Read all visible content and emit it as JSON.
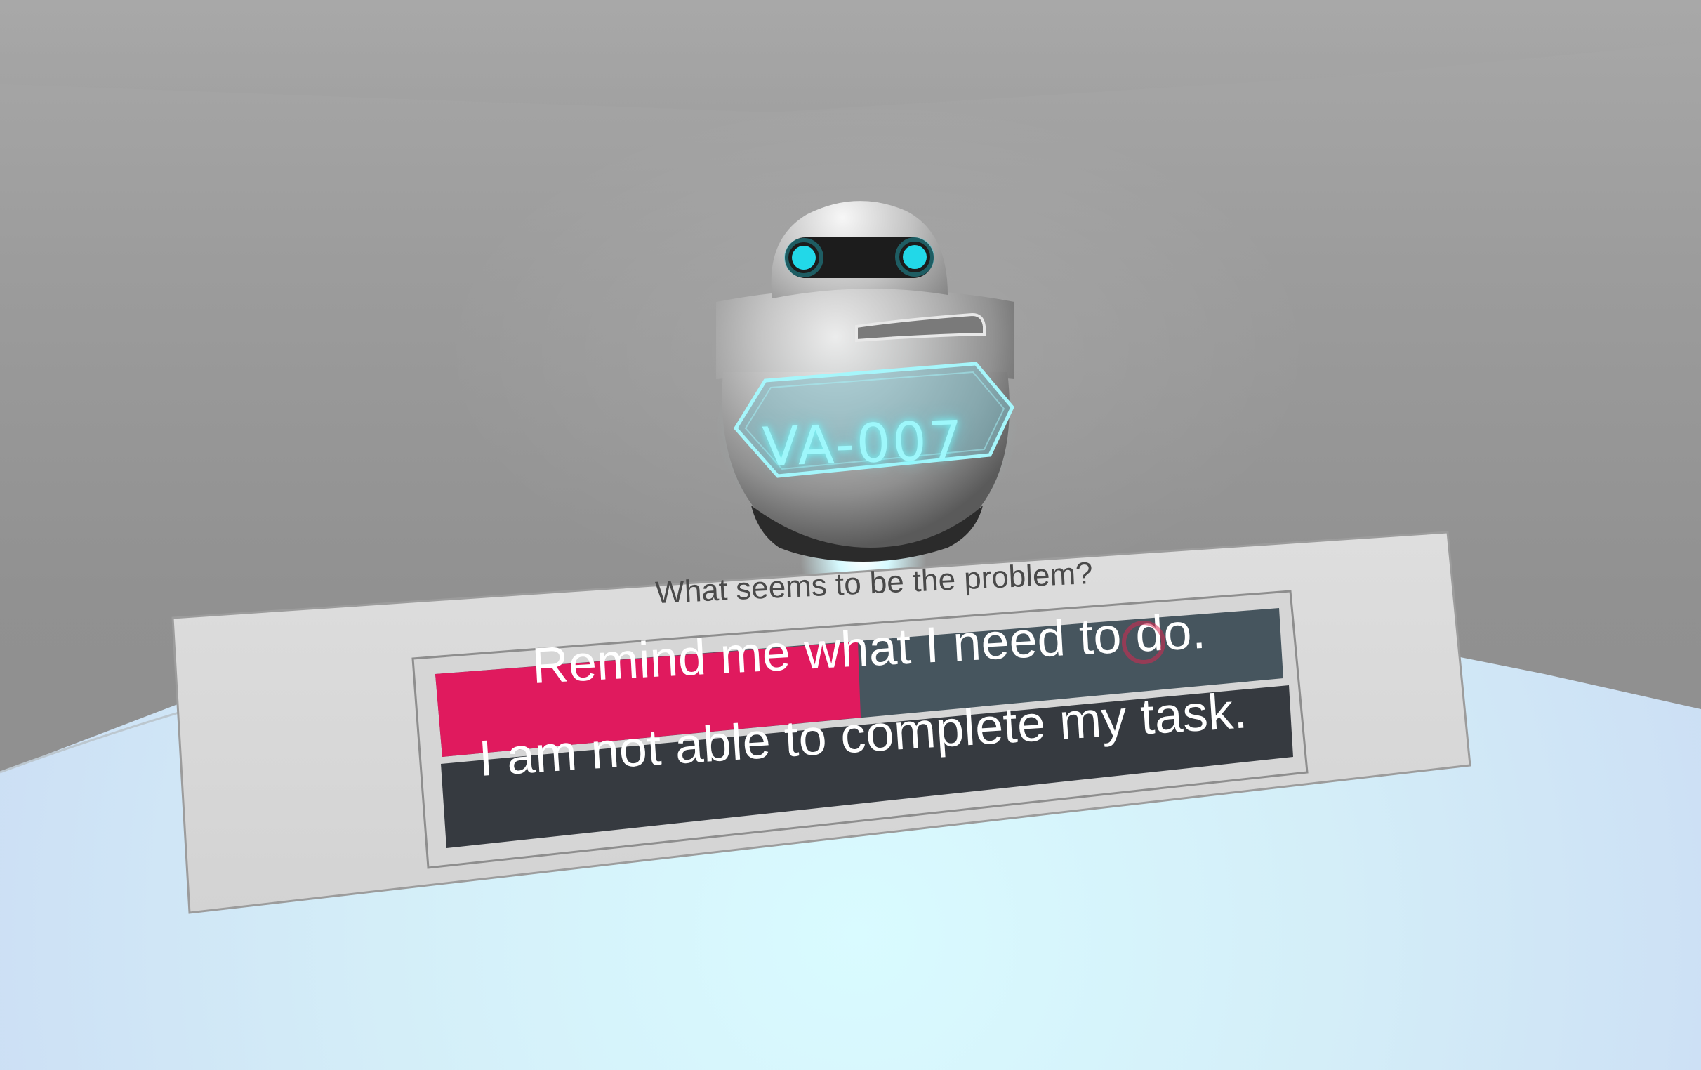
{
  "scene": {
    "robot_label": "VA-007",
    "robot_eye_color": "#22d8e8",
    "robot_glow_color": "#9ef7fb"
  },
  "dialog": {
    "prompt": "What seems to be the problem?",
    "options": [
      {
        "label": "Remind me what I need to do.",
        "state": "hover-filling",
        "progress": 0.45
      },
      {
        "label": "I am not able to complete my task."
      }
    ]
  },
  "colors": {
    "option_fill": "#e01a5e",
    "option_bg": "#46555e",
    "option_bg_dark": "#363a40",
    "panel": "#dadada",
    "floor": "#d6f2fb"
  }
}
